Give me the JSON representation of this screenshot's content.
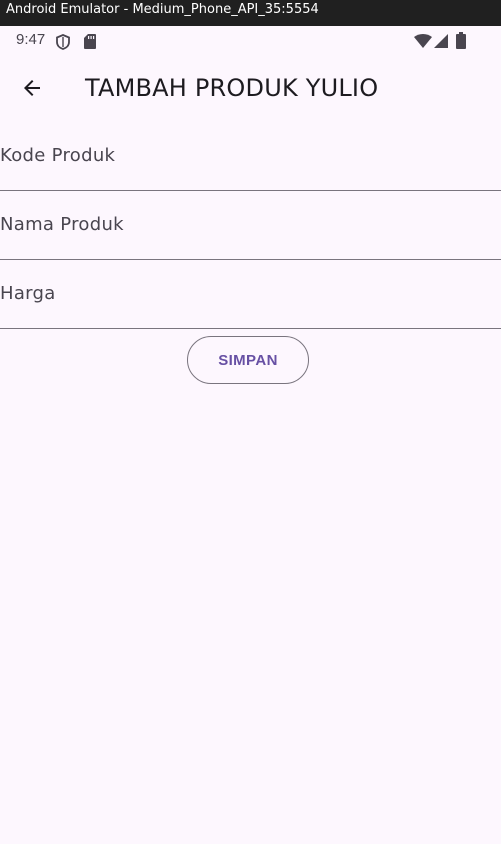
{
  "window": {
    "title": "Android Emulator - Medium_Phone_API_35:5554"
  },
  "status_bar": {
    "time": "9:47",
    "icons": [
      "shield-icon",
      "sd-card-icon",
      "wifi-icon",
      "signal-icon",
      "battery-icon"
    ]
  },
  "app_bar": {
    "back_icon": "arrow-back-icon",
    "title": "TAMBAH PRODUK YULIO"
  },
  "form": {
    "fields": [
      {
        "label": "Kode Produk",
        "value": ""
      },
      {
        "label": "Nama Produk",
        "value": ""
      },
      {
        "label": "Harga",
        "value": ""
      }
    ],
    "submit_label": "SIMPAN"
  },
  "colors": {
    "background": "#fdf7fe",
    "primary": "#6750a4",
    "on_surface": "#1d1b20",
    "on_surface_variant": "#49454f",
    "outline": "#79747e",
    "titlebar": "#202020"
  }
}
